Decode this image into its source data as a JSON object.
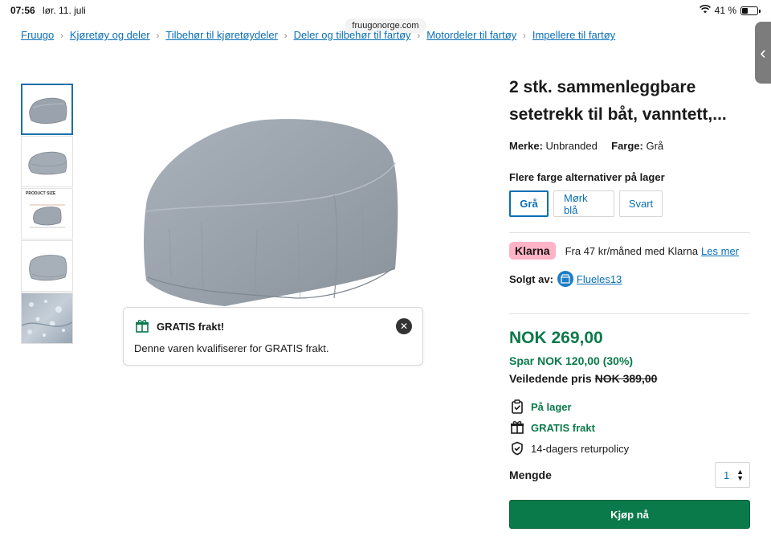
{
  "status_bar": {
    "time": "07:56",
    "date": "lør. 11. juli",
    "battery": "41 %",
    "battery_level": 0.41
  },
  "browser": {
    "url": "fruugonorge.com"
  },
  "breadcrumb": [
    "Fruugo",
    "Kjøretøy og deler",
    "Tilbehør til kjøretøydeler",
    "Deler og tilbehør til fartøy",
    "Motordeler til fartøy",
    "Impellere til fartøy"
  ],
  "gallery": {
    "thumbnails": [
      {
        "label": ""
      },
      {
        "label": ""
      },
      {
        "label": "PRODUCT SIZE"
      },
      {
        "label": ""
      },
      {
        "label": ""
      }
    ],
    "selected_index": 0
  },
  "toast": {
    "title": "GRATIS frakt!",
    "body": "Denne varen kvalifiserer for GRATIS frakt."
  },
  "product": {
    "title": "2 stk. sammenleggbare setetrekk til båt, vanntett,...",
    "brand_label": "Merke:",
    "brand_value": "Unbranded",
    "color_label": "Farge:",
    "color_value": "Grå",
    "color_options_heading": "Flere farge alternativer på lager",
    "color_options": [
      "Grå",
      "Mørk blå",
      "Svart"
    ],
    "klarna_badge": "Klarna",
    "klarna_text": "Fra 47 kr/måned med Klarna",
    "klarna_link": "Les mer",
    "seller_label": "Solgt av:",
    "seller_name": "Flueles13",
    "price": "NOK 269,00",
    "savings": "Spar NOK 120,00 (30%)",
    "rrp_label": "Veiledende pris",
    "rrp_value": "NOK 389,00",
    "features": [
      {
        "icon": "clipboard-check-icon",
        "label": "På lager"
      },
      {
        "icon": "gift-icon",
        "label": "GRATIS frakt"
      },
      {
        "icon": "shield-check-icon",
        "label": "14-dagers returpolicy"
      }
    ],
    "quantity_label": "Mengde",
    "quantity_value": "1",
    "buy_button": "Kjøp nå"
  },
  "colors": {
    "accent_green": "#0a7a4a",
    "link_blue": "#0a6fb5",
    "klarna_pink": "#ffb3c7"
  }
}
